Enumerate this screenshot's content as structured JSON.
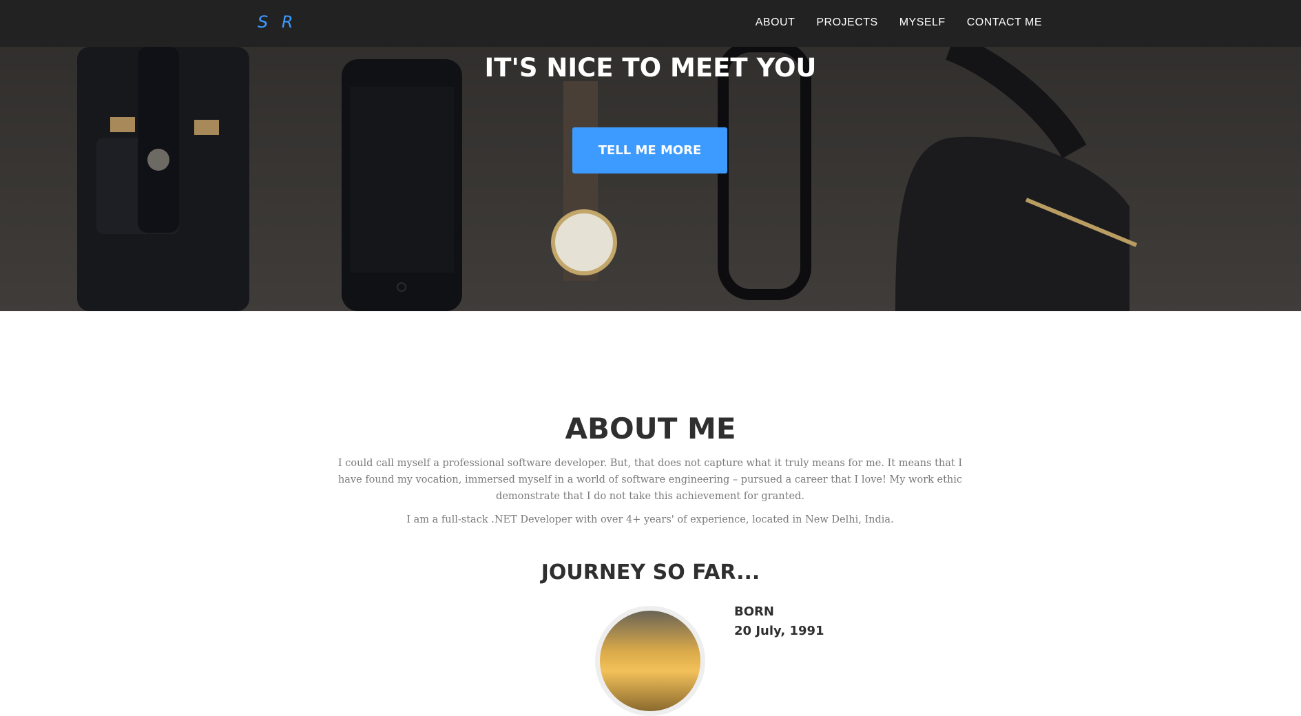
{
  "navbar": {
    "brand": "S R",
    "links": [
      "ABOUT",
      "PROJECTS",
      "MYSELF",
      "CONTACT ME"
    ]
  },
  "hero": {
    "heading": "IT'S NICE TO MEET YOU",
    "button_label": "TELL ME MORE"
  },
  "about": {
    "title": "ABOUT ME",
    "paragraphs": [
      "I could call myself a professional software developer. But, that does not capture what it truly means for me. It means that I have found my vocation, immersed myself in a world of software engineering – pursued a career that I love! My work ethic demonstrate that I do not take this achievement for granted.",
      "I am a full-stack .NET Developer with over 4+ years' of experience, located in New Delhi, India."
    ]
  },
  "journey": {
    "title": "JOURNEY SO FAR...",
    "items": [
      {
        "title": "BORN",
        "date": "20 July, 1991"
      }
    ]
  },
  "colors": {
    "accent": "#3d9bff",
    "navbar_bg": "#222222",
    "heading_text": "#2f2f2f",
    "body_text": "#7a7a7a"
  }
}
